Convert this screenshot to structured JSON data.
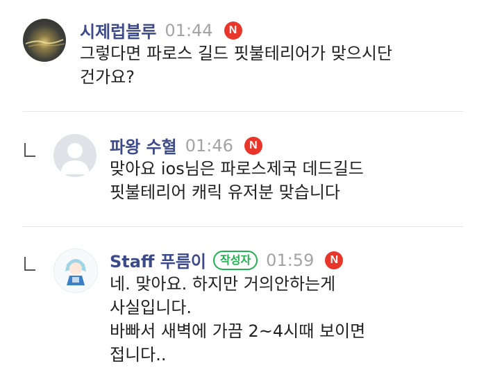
{
  "comments": [
    {
      "author": "시제럽블루",
      "time": "01:44",
      "new_badge": "N",
      "text": "그렇다면 파로스 길드 핏불테리어가 맞으시단\n건가요?"
    },
    {
      "author": "파왕 수혈",
      "time": "01:46",
      "new_badge": "N",
      "text": "맞아요 ios님은 파로스제국 데드길드\n핏불테리어 캐릭 유저분 맞습니다"
    },
    {
      "author": "Staff 푸름이",
      "author_badge": "작성자",
      "time": "01:59",
      "new_badge": "N",
      "text": "네. 맞아요. 하지만 거의안하는게\n사실입니다.\n바빠서 새벽에 가끔 2~4시때 보이면\n접니다.."
    }
  ],
  "colors": {
    "author": "#3d4a8a",
    "time": "#a3a3a3",
    "new_badge": "#e8372a",
    "author_badge": "#1fb14f"
  }
}
